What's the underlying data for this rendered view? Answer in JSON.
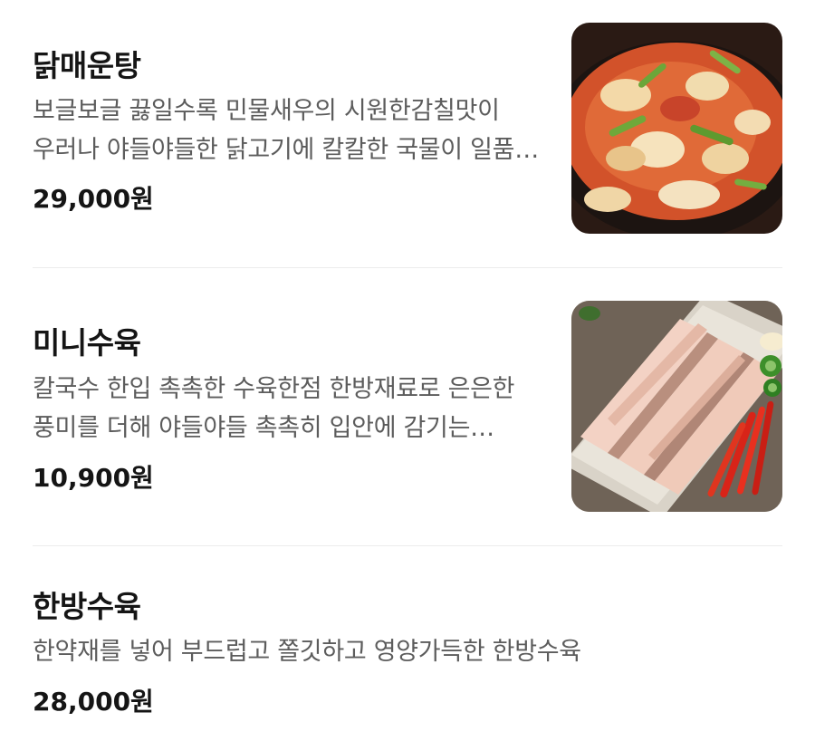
{
  "menu": {
    "items": [
      {
        "name": "닭매운탕",
        "description": "보글보글 끓일수록 민물새우의 시원한감칠맛이 우러나 야들야들한 닭고기에 칼칼한 국물이 일품인 닭매운탕",
        "price": "29,000원",
        "image": "spicy-chicken-stew-photo"
      },
      {
        "name": "미니수육",
        "description": "칼국수 한입 촉촉한 수육한점 한방재료로 은은한 풍미를 더해 야들야들 촉촉히 입안에 감기는 미니수육",
        "price": "10,900원",
        "image": "boiled-pork-slices-photo"
      },
      {
        "name": "한방수육",
        "description": "한약재를 넣어 부드럽고 쫄깃하고 영양가득한 한방수육",
        "price": "28,000원"
      }
    ]
  }
}
